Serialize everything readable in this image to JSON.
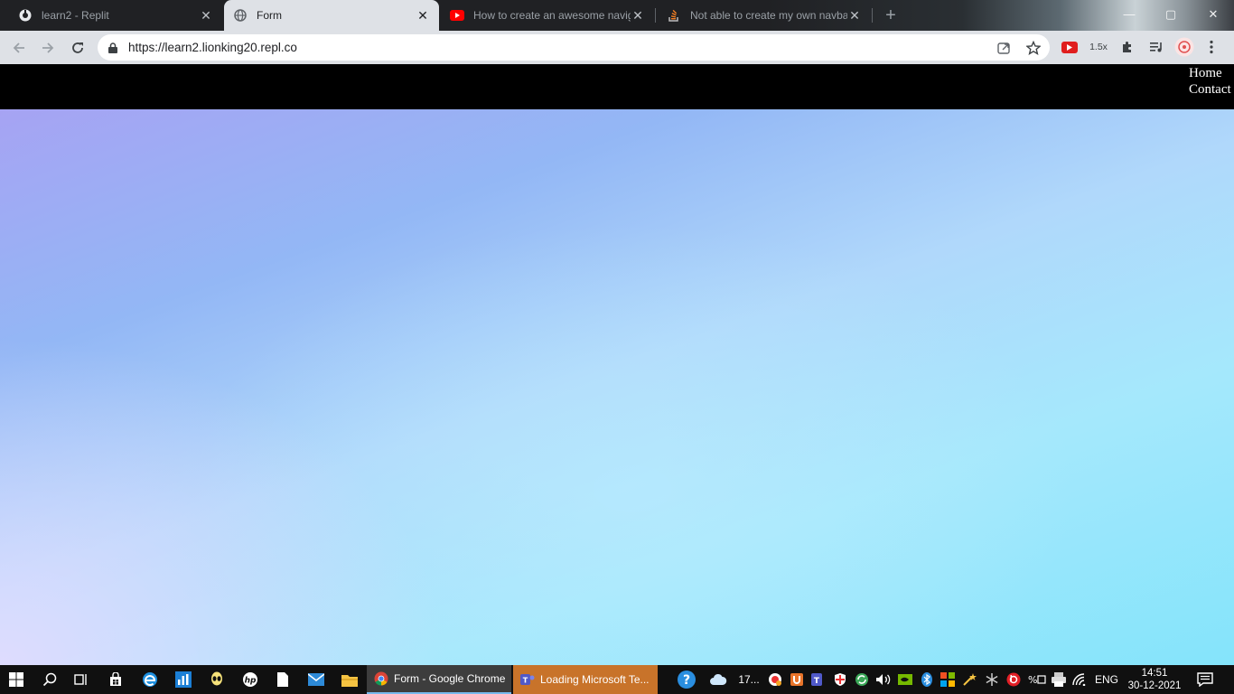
{
  "browser": {
    "tabs": [
      {
        "title": "learn2 - Replit",
        "active": false
      },
      {
        "title": "Form",
        "active": true
      },
      {
        "title": "How to create an awesome navig",
        "active": false
      },
      {
        "title": "Not able to create my own navba",
        "active": false
      }
    ],
    "url": "https://learn2.lionking20.repl.co",
    "speed_label": "1.5x"
  },
  "site": {
    "nav": [
      {
        "label": "Home"
      },
      {
        "label": "Contact"
      }
    ]
  },
  "taskbar": {
    "apps": [
      {
        "label": "Form - Google Chrome"
      },
      {
        "label": "Loading Microsoft Te..."
      }
    ],
    "weather_label": "17...",
    "language": "ENG",
    "time": "14:51",
    "date": "30-12-2021"
  },
  "colors": {
    "accent_blue": "#76b9ed",
    "teams_orange": "#c8732a",
    "youtube_red": "#ff0000",
    "navbar_black": "#000000"
  }
}
